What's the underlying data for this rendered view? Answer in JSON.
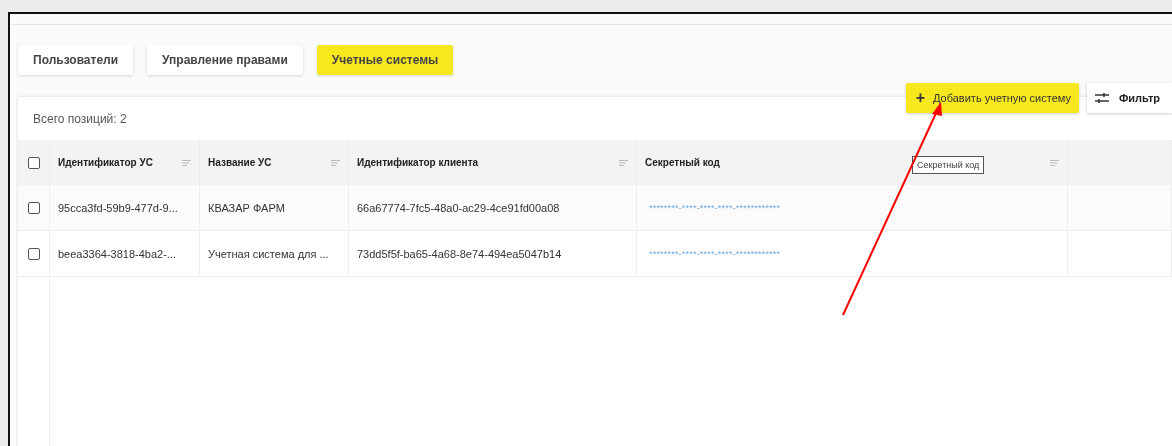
{
  "tabs": [
    {
      "label": "Пользователи",
      "selected": false
    },
    {
      "label": "Управление правами",
      "selected": false
    },
    {
      "label": "Учетные системы",
      "selected": true
    }
  ],
  "total": "Всего позиций: 2",
  "actions": {
    "add": {
      "icon": "+",
      "label": "Добавить учетную систему"
    },
    "filter": {
      "label": "Фильтр"
    }
  },
  "table": {
    "select_all": {
      "checked": false
    },
    "columns": [
      {
        "label": "Идентификатор УС"
      },
      {
        "label": "Название УС"
      },
      {
        "label": "Идентификатор клиента"
      },
      {
        "label": "Секретный код"
      }
    ],
    "rows": [
      {
        "checked": false,
        "cells": [
          "95cca3fd-59b9-477d-9...",
          "КВАЗАР ФАРМ",
          "66a67774-7fc5-48a0-ac29-4ce91fd00a08",
          "********-****-****-****-************"
        ]
      },
      {
        "checked": false,
        "cells": [
          "beea3364-3818-4ba2-...",
          "Учетная система для ...",
          "73dd5f5f-ba65-4a68-8e74-494ea5047b14",
          "********-****-****-****-************"
        ]
      }
    ]
  },
  "tooltip": "Секретный код"
}
